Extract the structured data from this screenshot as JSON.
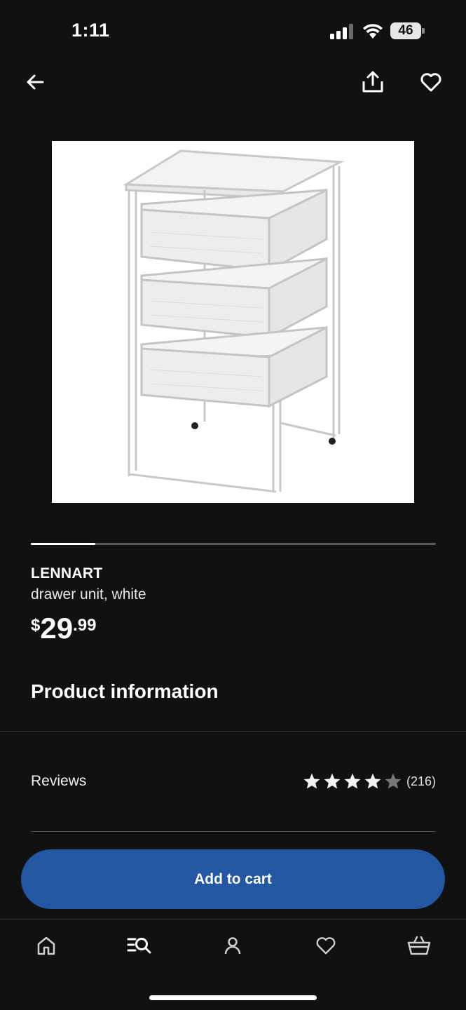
{
  "status_bar": {
    "time": "1:11",
    "battery": "46"
  },
  "product": {
    "name": "LENNART",
    "description": "drawer unit, white",
    "price": {
      "currency": "$",
      "integer": "29",
      "decimal": ".99"
    },
    "image_carousel_progress": 0.16
  },
  "sections": {
    "product_information": "Product information",
    "reviews": {
      "label": "Reviews",
      "rating": 4,
      "max_rating": 5,
      "count": "(216)"
    }
  },
  "actions": {
    "add_to_cart": "Add to cart"
  },
  "icons": {
    "back": "back-arrow-icon",
    "share": "share-icon",
    "favorite": "heart-icon"
  },
  "tab_bar": [
    {
      "icon": "home-icon"
    },
    {
      "icon": "search-list-icon"
    },
    {
      "icon": "profile-icon"
    },
    {
      "icon": "heart-icon"
    },
    {
      "icon": "basket-icon"
    }
  ],
  "colors": {
    "background": "#111111",
    "accent": "#2457a2",
    "star": "#f2f2f2",
    "star_empty": "#777777"
  }
}
